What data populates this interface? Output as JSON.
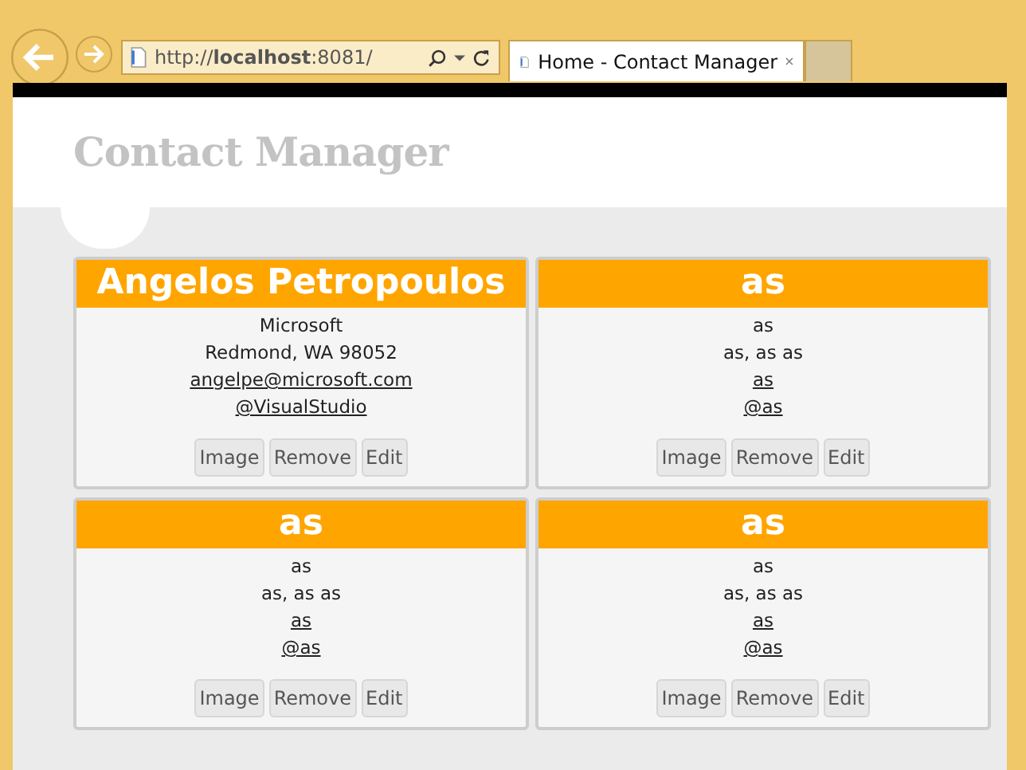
{
  "browser": {
    "address": "http://**localhost**:8081/",
    "tab": {
      "title": "Home - Contact Manager",
      "selected": true
    }
  },
  "page": {
    "title": "Contact Manager"
  },
  "contacts": [
    {
      "name": "Angelos Petropoulos",
      "company": "Microsoft",
      "address": "Redmond, WA 98052",
      "email": "angelpe@microsoft.com",
      "twitter": "@VisualStudio",
      "buttons": [
        "Image",
        "Remove",
        "Edit"
      ]
    },
    {
      "name": "as",
      "company": "as",
      "address": "as, as as",
      "email": "as",
      "twitter": "@as",
      "buttons": [
        "Image",
        "Remove",
        "Edit"
      ]
    },
    {
      "name": "as",
      "company": "as",
      "address": "as, as as",
      "email": "as",
      "twitter": "@as",
      "buttons": [
        "Image",
        "Remove",
        "Edit"
      ]
    },
    {
      "name": "as",
      "company": "as",
      "address": "as, as as",
      "email": "as",
      "twitter": "@as",
      "buttons": [
        "Image",
        "Remove",
        "Edit"
      ]
    }
  ]
}
